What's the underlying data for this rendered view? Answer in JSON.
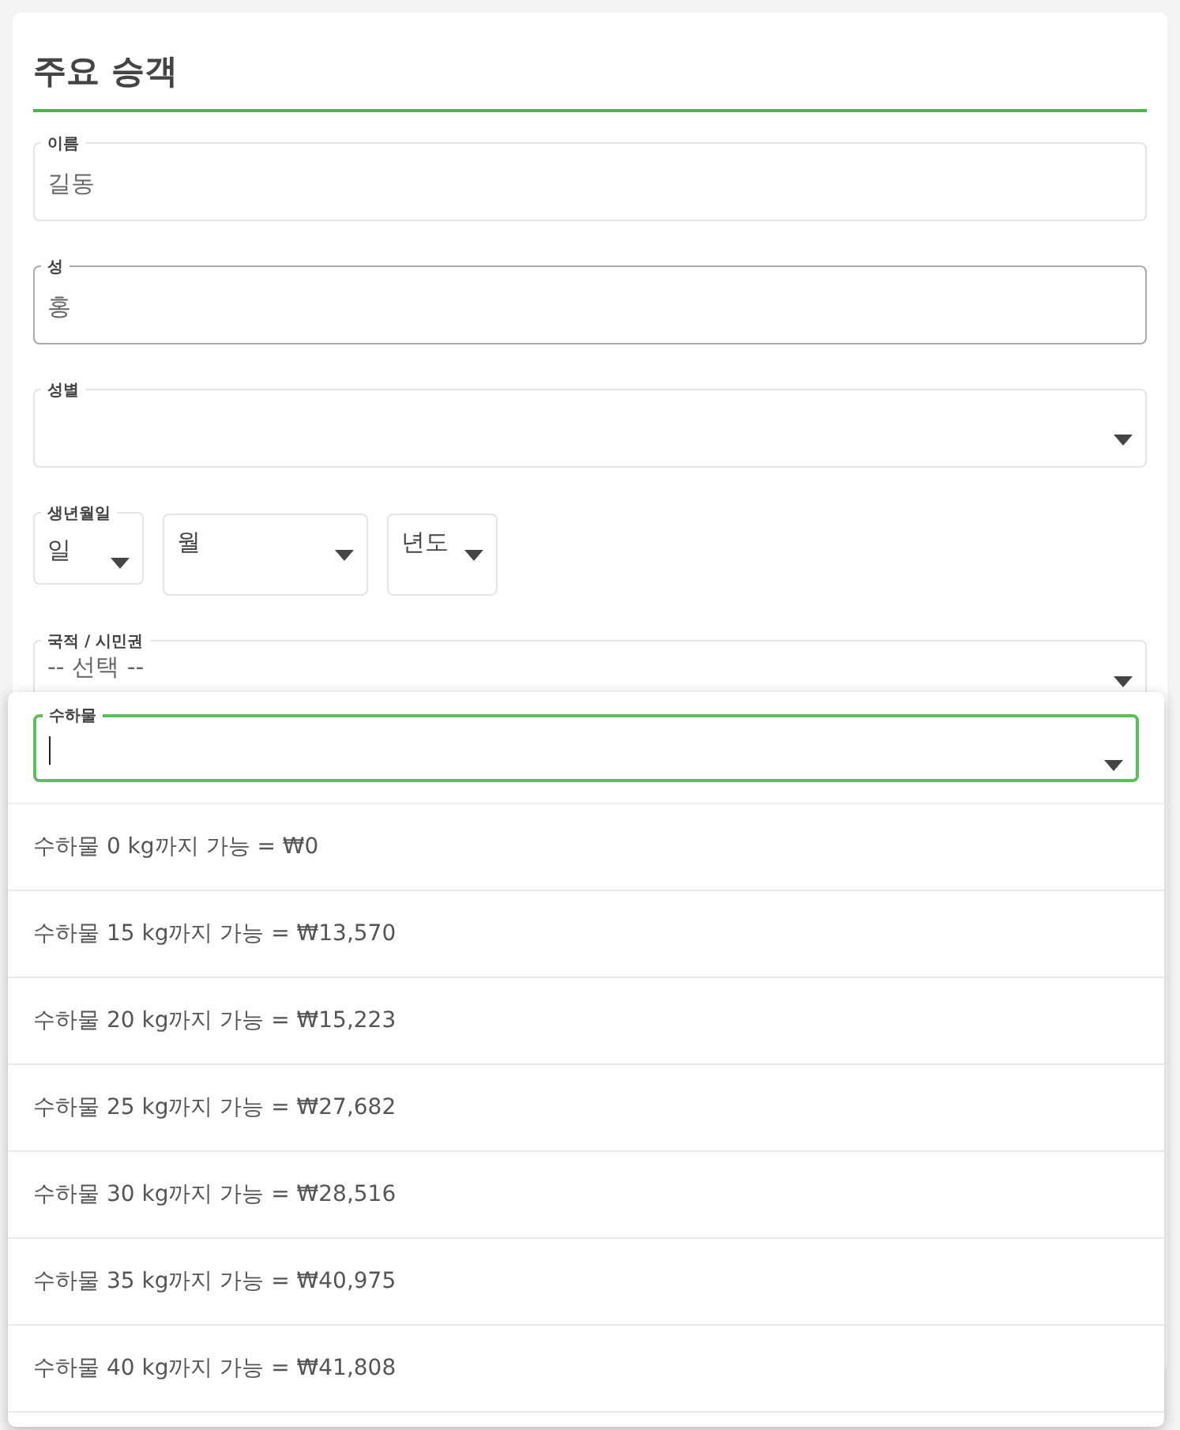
{
  "section": {
    "title": "주요 승객"
  },
  "fields": [
    {
      "kind": "text",
      "label": "이름",
      "value": "길동",
      "focused": false
    },
    {
      "kind": "text",
      "label": "성",
      "value": "홍",
      "focused": true
    },
    {
      "kind": "select",
      "label": "성별",
      "focused": false
    },
    {
      "kind": "date",
      "label": "생년월일",
      "parts": [
        {
          "value": "일"
        },
        {
          "value": "월"
        },
        {
          "value": "년도"
        }
      ]
    },
    {
      "kind": "select",
      "label": "국적 / 시민권",
      "value": "-- 선택 --",
      "focused": false
    }
  ],
  "baggage": {
    "label": "수하물",
    "open": true,
    "options": [
      {
        "label": "수하물 0 kg까지 가능 = ₩0"
      },
      {
        "label": "수하물 15 kg까지 가능 = ₩13,570"
      },
      {
        "label": "수하물 20 kg까지 가능 = ₩15,223"
      },
      {
        "label": "수하물 25 kg까지 가능 = ₩27,682"
      },
      {
        "label": "수하물 30 kg까지 가능 = ₩28,516"
      },
      {
        "label": "수하물 35 kg까지 가능 = ₩40,975"
      },
      {
        "label": "수하물 40 kg까지 가능 = ₩41,808"
      }
    ]
  }
}
